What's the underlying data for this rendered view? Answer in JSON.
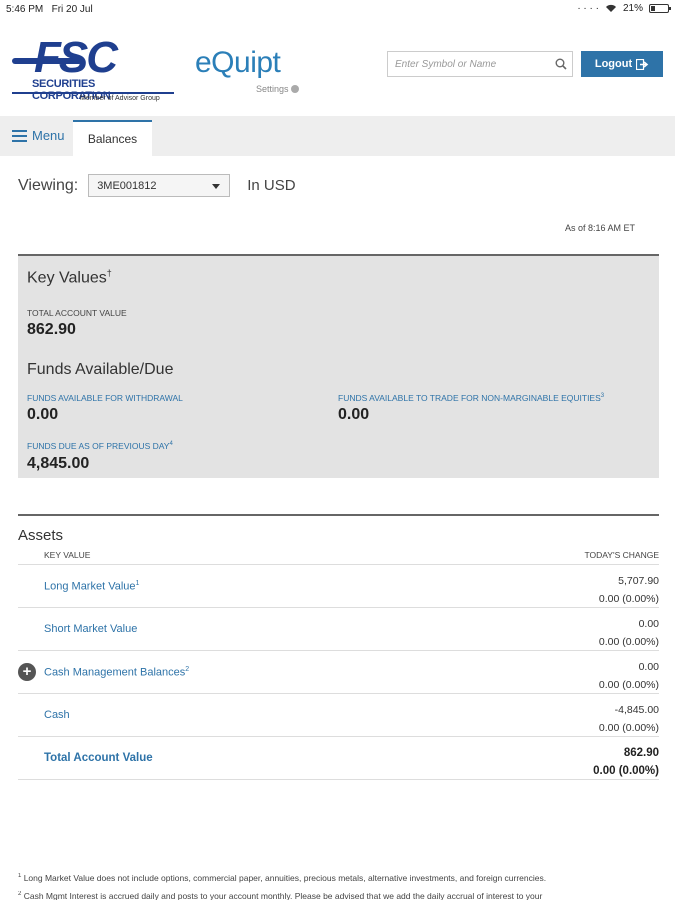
{
  "status": {
    "time": "5:46 PM",
    "date": "Fri 20 Jul",
    "battery": "21%"
  },
  "brand": {
    "logo_text": "FSC",
    "logo_subtitle": "SECURITIES CORPORATION",
    "logo_member": "Member of Advisor Group",
    "app_name": "eQuipt",
    "settings_label": "Settings"
  },
  "search": {
    "placeholder": "Enter Symbol or Name"
  },
  "logout_label": "Logout",
  "nav": {
    "menu_label": "Menu",
    "active_tab": "Balances"
  },
  "viewing": {
    "label": "Viewing:",
    "account": "3ME001812",
    "currency": "In USD"
  },
  "as_of": "As of 8:16 AM ET",
  "key_values": {
    "title": "Key Values",
    "title_marker": "†",
    "total_account_value_label": "TOTAL ACCOUNT VALUE",
    "total_account_value": "862.90",
    "funds_title": "Funds Available/Due",
    "funds_withdrawal_label": "FUNDS AVAILABLE FOR WITHDRAWAL",
    "funds_withdrawal": "0.00",
    "funds_trade_label": "FUNDS AVAILABLE TO TRADE FOR NON-MARGINABLE EQUITIES",
    "funds_trade_marker": "3",
    "funds_trade": "0.00",
    "funds_due_label": "FUNDS DUE AS OF PREVIOUS DAY",
    "funds_due_marker": "4",
    "funds_due": "4,845.00"
  },
  "assets": {
    "title": "Assets",
    "col_key": "KEY VALUE",
    "col_change": "TODAY'S CHANGE",
    "rows": [
      {
        "name": "Long Market Value",
        "marker": "1",
        "value": "5,707.90",
        "change": "0.00  (0.00%)"
      },
      {
        "name": "Short Market Value",
        "marker": "",
        "value": "0.00",
        "change": "0.00  (0.00%)"
      },
      {
        "name": "Cash Management Balances",
        "marker": "2",
        "value": "0.00",
        "change": "0.00  (0.00%)"
      },
      {
        "name": "Cash",
        "marker": "",
        "value": "-4,845.00",
        "change": "0.00  (0.00%)"
      },
      {
        "name": "Total Account Value",
        "marker": "",
        "value": "862.90",
        "change": "0.00  (0.00%)"
      }
    ]
  },
  "footnotes": [
    {
      "marker": "1",
      "text": " Long Market Value does not include options, commercial paper, annuities, precious metals, alternative investments, and foreign currencies."
    },
    {
      "marker": "2",
      "text": " Cash Mgmt Interest is accrued daily and posts to your account monthly. Please be advised that we add the daily accrual of interest to your"
    }
  ]
}
